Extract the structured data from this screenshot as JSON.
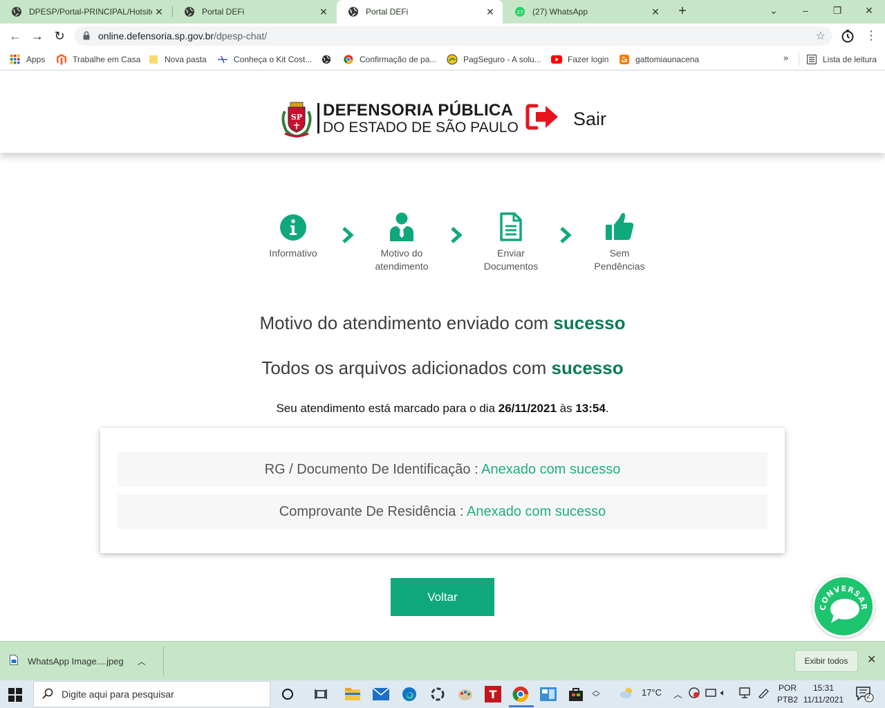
{
  "browser": {
    "tabs": [
      {
        "title": "DPESP/Portal-PRINCIPAL/Hotsite",
        "active": false
      },
      {
        "title": "Portal DEFi",
        "active": false
      },
      {
        "title": "Portal DEFi",
        "active": true
      },
      {
        "title": "(27) WhatsApp",
        "active": false
      }
    ],
    "url_host": "online.defensoria.sp.gov.br",
    "url_path": "/dpesp-chat/",
    "bookmarks": [
      {
        "label": "Apps",
        "icon": "apps-grid-icon"
      },
      {
        "label": "Trabalhe em Casa",
        "icon": "magento-icon"
      },
      {
        "label": "Nova pasta",
        "icon": "folder-icon"
      },
      {
        "label": "Conheça o Kit Cost...",
        "icon": "tool-icon"
      },
      {
        "label": "",
        "icon": "globe-icon"
      },
      {
        "label": "Confirmação de pa...",
        "icon": "chrome-icon"
      },
      {
        "label": "PagSeguro - A solu...",
        "icon": "pagseguro-icon"
      },
      {
        "label": "Fazer login",
        "icon": "youtube-icon"
      },
      {
        "label": "gattomiaunacena",
        "icon": "blogger-icon"
      }
    ],
    "bookmarks_more": "»",
    "reading_list": "Lista de leitura"
  },
  "header": {
    "logo_line1": "DEFENSORIA PÚBLICA",
    "logo_line2": "DO ESTADO DE SÃO PAULO",
    "logout_label": "Sair"
  },
  "steps": [
    {
      "label": "Informativo",
      "icon": "info-icon"
    },
    {
      "label": "Motivo do atendimento",
      "icon": "person-icon"
    },
    {
      "label": "Enviar Documentos",
      "icon": "document-icon"
    },
    {
      "label": "Sem Pendências",
      "icon": "thumbs-up-icon"
    }
  ],
  "messages": {
    "reason_prefix": "Motivo do atendimento enviado com ",
    "reason_highlight": "sucesso",
    "files_prefix": "Todos os arquivos adicionados com ",
    "files_highlight": "sucesso",
    "schedule_prefix": "Seu atendimento está marcado para o dia ",
    "schedule_date": "26/11/2021",
    "schedule_mid": " às ",
    "schedule_time": "13:54",
    "schedule_suffix": "."
  },
  "documents": [
    {
      "label": "RG / Documento De Identificação : ",
      "status": "Anexado com sucesso"
    },
    {
      "label": "Comprovante De Residência : ",
      "status": "Anexado com sucesso"
    }
  ],
  "back_button": "Voltar",
  "chat_label": "CONVERSAR",
  "download": {
    "filename": "WhatsApp Image....jpeg",
    "show_all": "Exibir todos"
  },
  "taskbar": {
    "search_placeholder": "Digite aqui para pesquisar",
    "temperature": "17°C",
    "lang_line1": "POR",
    "lang_line2": "PTB2",
    "time": "15:31",
    "date": "11/11/2021",
    "notifications": "2"
  },
  "colors": {
    "accent_green": "#0fa87c",
    "success_dark": "#0b7a55",
    "success_light": "#20b07a",
    "logout_red": "#e8141c",
    "browser_frame": "#c7e6c7"
  }
}
